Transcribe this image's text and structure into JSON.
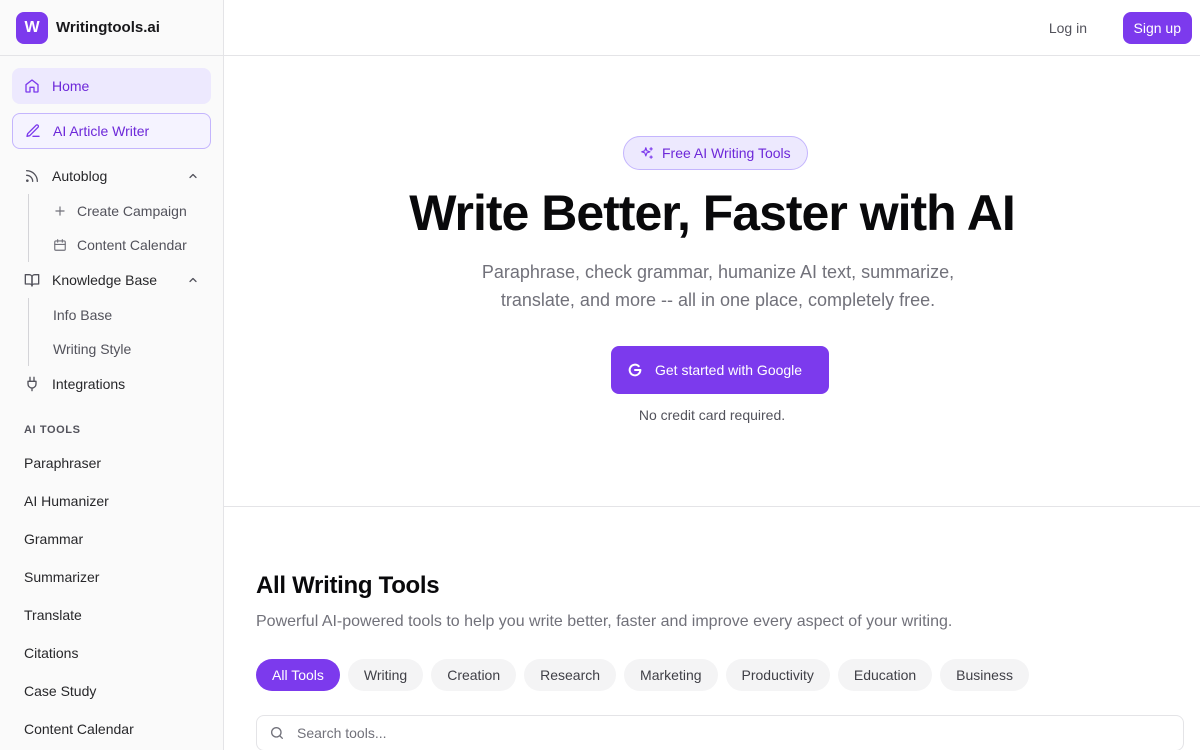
{
  "brand": {
    "logo_letter": "W",
    "name": "Writingtools.ai"
  },
  "colors": {
    "accent": "#7c3aed",
    "accent_soft": "#ede9fe"
  },
  "sidebar": {
    "home": {
      "label": "Home",
      "icon": "home-icon"
    },
    "article_writer": {
      "label": "AI Article Writer",
      "icon": "pencil-icon"
    },
    "autoblog": {
      "label": "Autoblog",
      "icon": "rss-icon",
      "children": [
        {
          "label": "Create Campaign",
          "icon": "plus-icon"
        },
        {
          "label": "Content Calendar",
          "icon": "calendar-icon"
        }
      ]
    },
    "knowledge_base": {
      "label": "Knowledge Base",
      "icon": "book-icon",
      "children": [
        {
          "label": "Info Base"
        },
        {
          "label": "Writing Style"
        }
      ]
    },
    "integrations": {
      "label": "Integrations",
      "icon": "plug-icon"
    },
    "ai_tools_label": "AI TOOLS",
    "tools": [
      "Paraphraser",
      "AI Humanizer",
      "Grammar",
      "Summarizer",
      "Translate",
      "Citations",
      "Case Study",
      "Content Calendar"
    ]
  },
  "topbar": {
    "login": "Log in",
    "signup": "Sign up"
  },
  "hero": {
    "badge": "Free AI Writing Tools",
    "title": "Write Better, Faster with AI",
    "subtitle": "Paraphrase, check grammar, humanize AI text, summarize, translate, and more -- all in one place, completely free.",
    "cta": "Get started with Google",
    "note": "No credit card required."
  },
  "tools_section": {
    "title": "All Writing Tools",
    "subtitle": "Powerful AI-powered tools to help you write better, faster and improve every aspect of your writing.",
    "filters": [
      "All Tools",
      "Writing",
      "Creation",
      "Research",
      "Marketing",
      "Productivity",
      "Education",
      "Business"
    ],
    "active_filter": "All Tools",
    "search_placeholder": "Search tools..."
  }
}
